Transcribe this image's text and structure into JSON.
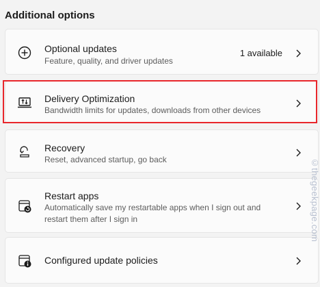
{
  "section": {
    "title": "Additional options"
  },
  "items": [
    {
      "title": "Optional updates",
      "subtitle": "Feature, quality, and driver updates",
      "right_text": "1 available",
      "icon": "plus-circle-icon"
    },
    {
      "title": "Delivery Optimization",
      "subtitle": "Bandwidth limits for updates, downloads from other devices",
      "icon": "delivery-optimization-icon",
      "highlighted": true,
      "highlight_color": "#e8262b"
    },
    {
      "title": "Recovery",
      "subtitle": "Reset, advanced startup, go back",
      "icon": "recovery-icon"
    },
    {
      "title": "Restart apps",
      "subtitle_line1": "Automatically save my restartable apps when I sign out and",
      "subtitle_line2": "restart them after I sign in",
      "icon": "restart-apps-icon"
    },
    {
      "title": "Configured update policies",
      "icon": "update-policies-icon"
    }
  ],
  "watermark": "©thegeekpage.com"
}
